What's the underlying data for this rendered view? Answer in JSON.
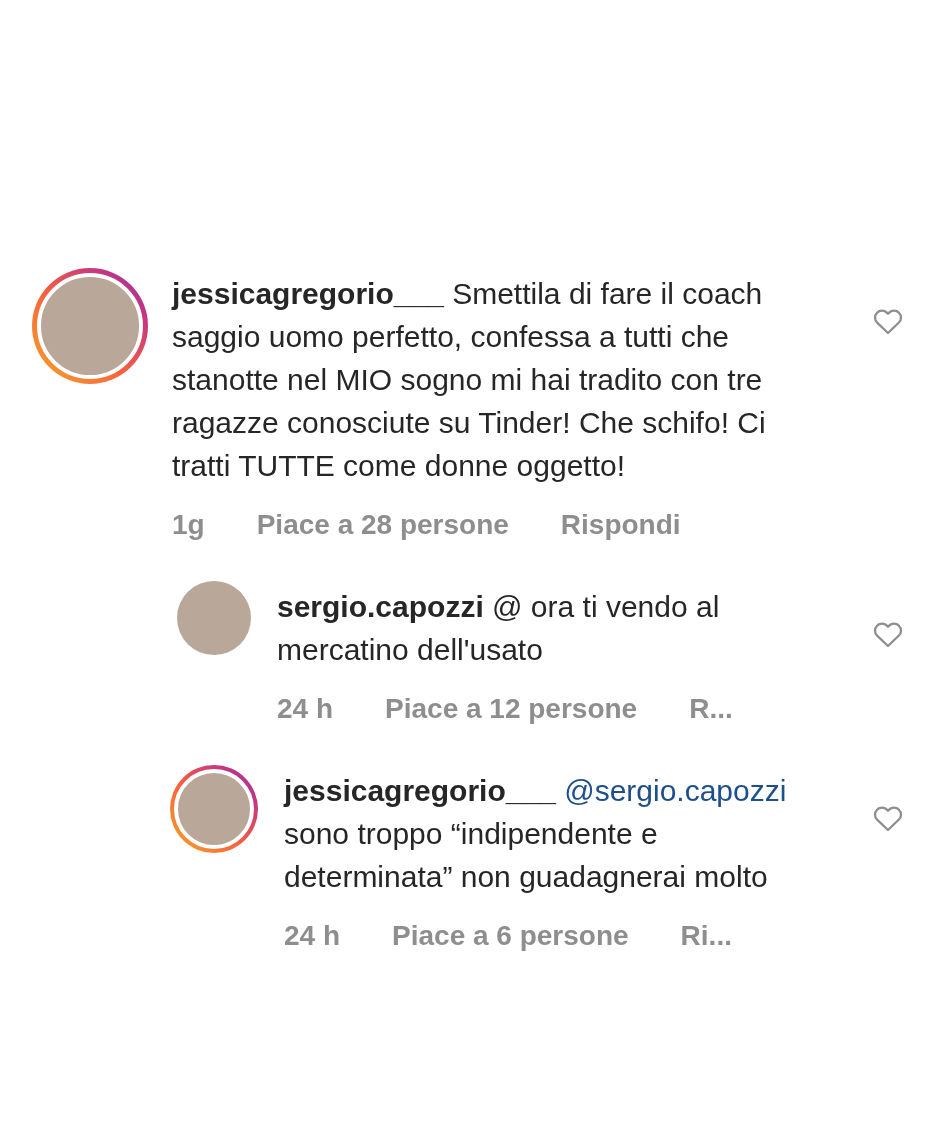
{
  "comments": [
    {
      "username": "jessicagregorio___",
      "text": "Smettila di fare il coach saggio uomo perfetto, confessa a tutti che stanotte nel MIO sogno mi hai tradito con tre ragazze conosciute su Tinder! Che schifo! Ci tratti TUTTE come donne oggetto!",
      "time": "1g",
      "likes": "Piace a 28 persone",
      "reply": "Rispondi",
      "story_ring": true,
      "liked": false,
      "replies": [
        {
          "username": "sergio.capozzi",
          "text": "@ ora ti vendo al mercatino dell'usato",
          "time": "24 h",
          "likes": "Piace a 12 persone",
          "reply": "R...",
          "story_ring": false,
          "liked": false
        },
        {
          "username": "jessicagregorio___",
          "mention": "@sergio.capozzi",
          "text": "sono troppo “indipendente e determinata” non guadagnerai molto",
          "time": "24 h",
          "likes": "Piace a 6 persone",
          "reply": "Ri...",
          "story_ring": true,
          "liked": false
        }
      ]
    }
  ]
}
